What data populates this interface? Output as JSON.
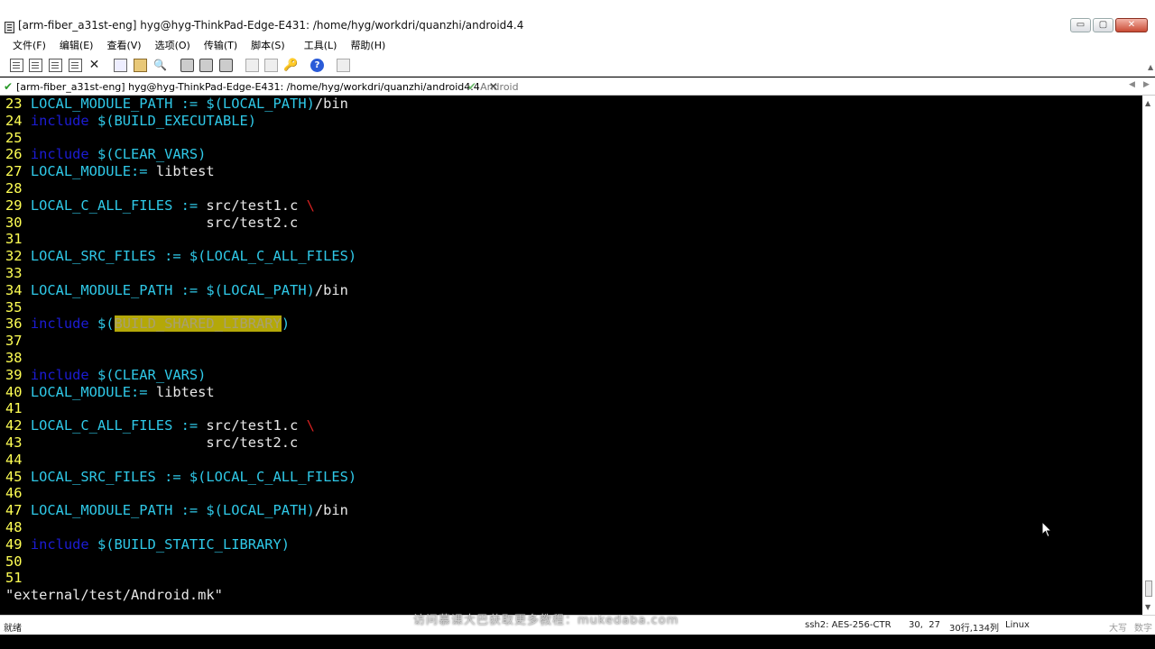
{
  "window": {
    "title": "[arm-fiber_a31st-eng] hyg@hyg-ThinkPad-Edge-E431: /home/hyg/workdri/quanzhi/android4.4",
    "minimize": "▭",
    "maximize": "▢",
    "close": "✕"
  },
  "menu": {
    "items": [
      "文件(F)",
      "编辑(E)",
      "查看(V)",
      "选项(O)",
      "传输(T)",
      "脚本(S)",
      "工具(L)",
      "帮助(H)"
    ]
  },
  "tabs": {
    "active_label": "[arm-fiber_a31st-eng] hyg@hyg-ThinkPad-Edge-E431: /home/hyg/workdri/quanzhi/android4.4",
    "close_glyph": "✕",
    "inactive_label": "Android",
    "check_glyph": "✔",
    "prev_glyph": "◀",
    "next_glyph": "▶"
  },
  "terminal": {
    "lines": [
      {
        "n": "23",
        "parts": [
          {
            "t": "LOCAL_MODULE_PATH := $(LOCAL_PATH)",
            "c": "var"
          },
          {
            "t": "/bin",
            "c": "plain"
          }
        ]
      },
      {
        "n": "24",
        "parts": [
          {
            "t": "include",
            "c": "kw"
          },
          {
            "t": " $(BUILD_EXECUTABLE)",
            "c": "var"
          }
        ]
      },
      {
        "n": "25",
        "parts": []
      },
      {
        "n": "26",
        "parts": [
          {
            "t": "include",
            "c": "kw"
          },
          {
            "t": " $(CLEAR_VARS)",
            "c": "var"
          }
        ]
      },
      {
        "n": "27",
        "parts": [
          {
            "t": "LOCAL_MODULE:=",
            "c": "var"
          },
          {
            "t": " libtest",
            "c": "plain"
          }
        ]
      },
      {
        "n": "28",
        "parts": []
      },
      {
        "n": "29",
        "parts": [
          {
            "t": "LOCAL_C_ALL_FILES :=",
            "c": "var"
          },
          {
            "t": " src/test1.c ",
            "c": "plain"
          },
          {
            "t": "\\",
            "c": "bs"
          }
        ]
      },
      {
        "n": "30",
        "parts": [
          {
            "t": "                     src/test2.c",
            "c": "plain"
          }
        ]
      },
      {
        "n": "31",
        "parts": []
      },
      {
        "n": "32",
        "parts": [
          {
            "t": "LOCAL_SRC_FILES := $(LOCAL_C_ALL_FILES)",
            "c": "var"
          }
        ]
      },
      {
        "n": "33",
        "parts": []
      },
      {
        "n": "34",
        "parts": [
          {
            "t": "LOCAL_MODULE_PATH := $(LOCAL_PATH)",
            "c": "var"
          },
          {
            "t": "/bin",
            "c": "plain"
          }
        ]
      },
      {
        "n": "35",
        "parts": []
      },
      {
        "n": "36",
        "parts": [
          {
            "t": "include",
            "c": "kw"
          },
          {
            "t": " $(",
            "c": "var"
          },
          {
            "t": "BUILD_SHARED_LIBRARY",
            "c": "hl"
          },
          {
            "t": ")",
            "c": "var"
          }
        ]
      },
      {
        "n": "37",
        "parts": []
      },
      {
        "n": "38",
        "parts": []
      },
      {
        "n": "39",
        "parts": [
          {
            "t": "include",
            "c": "kw"
          },
          {
            "t": " $(CLEAR_VARS)",
            "c": "var"
          }
        ]
      },
      {
        "n": "40",
        "parts": [
          {
            "t": "LOCAL_MODULE:=",
            "c": "var"
          },
          {
            "t": " libtest",
            "c": "plain"
          }
        ]
      },
      {
        "n": "41",
        "parts": []
      },
      {
        "n": "42",
        "parts": [
          {
            "t": "LOCAL_C_ALL_FILES :=",
            "c": "var"
          },
          {
            "t": " src/test1.c ",
            "c": "plain"
          },
          {
            "t": "\\",
            "c": "bs"
          }
        ]
      },
      {
        "n": "43",
        "parts": [
          {
            "t": "                     src/test2.c",
            "c": "plain"
          }
        ]
      },
      {
        "n": "44",
        "parts": []
      },
      {
        "n": "45",
        "parts": [
          {
            "t": "LOCAL_SRC_FILES := $(LOCAL_C_ALL_FILES)",
            "c": "var"
          }
        ]
      },
      {
        "n": "46",
        "parts": []
      },
      {
        "n": "47",
        "parts": [
          {
            "t": "LOCAL_MODULE_PATH := $(LOCAL_PATH)",
            "c": "var"
          },
          {
            "t": "/bin",
            "c": "plain"
          }
        ]
      },
      {
        "n": "48",
        "parts": []
      },
      {
        "n": "49",
        "parts": [
          {
            "t": "include",
            "c": "kw"
          },
          {
            "t": " $(BUILD_STATIC_LIBRARY)",
            "c": "var"
          }
        ]
      },
      {
        "n": "50",
        "parts": []
      },
      {
        "n": "51",
        "parts": []
      }
    ],
    "command_line": "\"external/test/Android.mk\""
  },
  "status": {
    "ready": "就绪",
    "protocol": "ssh2: AES-256-CTR",
    "cursor_pos": "30,  27",
    "size": "30行,134列",
    "os": "Linux",
    "caps": "大写",
    "num": "数字"
  },
  "watermark": "访问慕课大巴获取更多教程：mukedaba.com",
  "colors": {
    "line_number": "#ffff54",
    "keyword": "#1c1cd4",
    "variable": "#2fc9e8",
    "plain_text": "#e8e8e8",
    "backslash": "#d42020",
    "highlight_bg": "#b4a808"
  },
  "icons": {
    "app": "securecrt-terminal-icon",
    "cursor": "mouse-pointer-icon"
  }
}
